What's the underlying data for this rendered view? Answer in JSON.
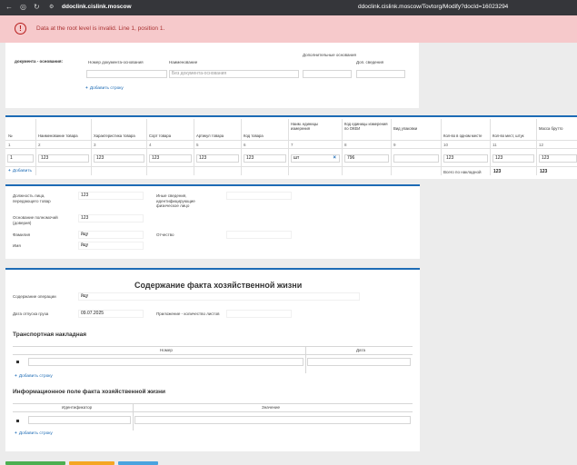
{
  "browser": {
    "host": "ddoclink.cislink.moscow",
    "url": "ddoclink.cislink.moscow/Tovtorg/Modify?docId=16023294"
  },
  "error": {
    "message": "Data at the root level is invalid. Line 1, position 1."
  },
  "basis": {
    "section_label": "документа - основания:",
    "col_number": "Номер документа-основания",
    "col_name": "Наименование",
    "col_additional": "Дополнительные основания",
    "col_extra": "Доп. сведения",
    "name_placeholder": "Без документа-основания",
    "add_row": "Добавить строку"
  },
  "goods": {
    "headers": [
      "№",
      "Наименование товара",
      "Характеристика товара",
      "Сорт товара",
      "Артикул товара",
      "Код товара",
      "Наим. единицы измерения",
      "Код единицы измерения по ОКЕИ",
      "Вид упаковки",
      "Кол-во в одном месте",
      "Кол-во мест, штук",
      "Масса брутто"
    ],
    "col_numbers": [
      "1",
      "2",
      "3",
      "4",
      "5",
      "6",
      "7",
      "8",
      "9",
      "10",
      "11",
      "12"
    ],
    "row": [
      "1",
      "123",
      "123",
      "123",
      "123",
      "123",
      "шт",
      "796",
      "",
      "123",
      "123",
      "123"
    ],
    "clear_icon": "×",
    "add": "Добавить",
    "total_label": "Всего по накладной",
    "total_places": "123",
    "total_mass": "123"
  },
  "persons": {
    "position_label": "Должность лица, передающего товар",
    "position_value": "123",
    "other_label": "Иные сведения, идентифицирующие физическое лицо",
    "authority_label": "Основание полномочий (доверия)",
    "authority_value": "123",
    "surname_label": "Фамилия",
    "surname_value": "йцу",
    "patronymic_label": "Отчество",
    "name_label": "Имя",
    "name_value": "йцу"
  },
  "fact": {
    "title": "Содержание факта хозяйственной жизни",
    "operation_label": "Содержание операции",
    "operation_value": "йцу",
    "date_label": "Дата отпуска груза",
    "date_value": "09.07.2025",
    "appendix_label": "Приложение - количество листов",
    "transport_title": "Транспортная накладная",
    "transport_col_number": "Номер",
    "transport_col_date": "Дата",
    "add_row": "Добавить строку",
    "info_title": "Информационное поле факта хозяйственной жизни",
    "info_col_id": "Идентификатор",
    "info_col_value": "Значение"
  },
  "colors": {
    "accent": "#1d6bb5",
    "error_bg": "#f6c9cb",
    "error_text": "#b71c1c"
  }
}
